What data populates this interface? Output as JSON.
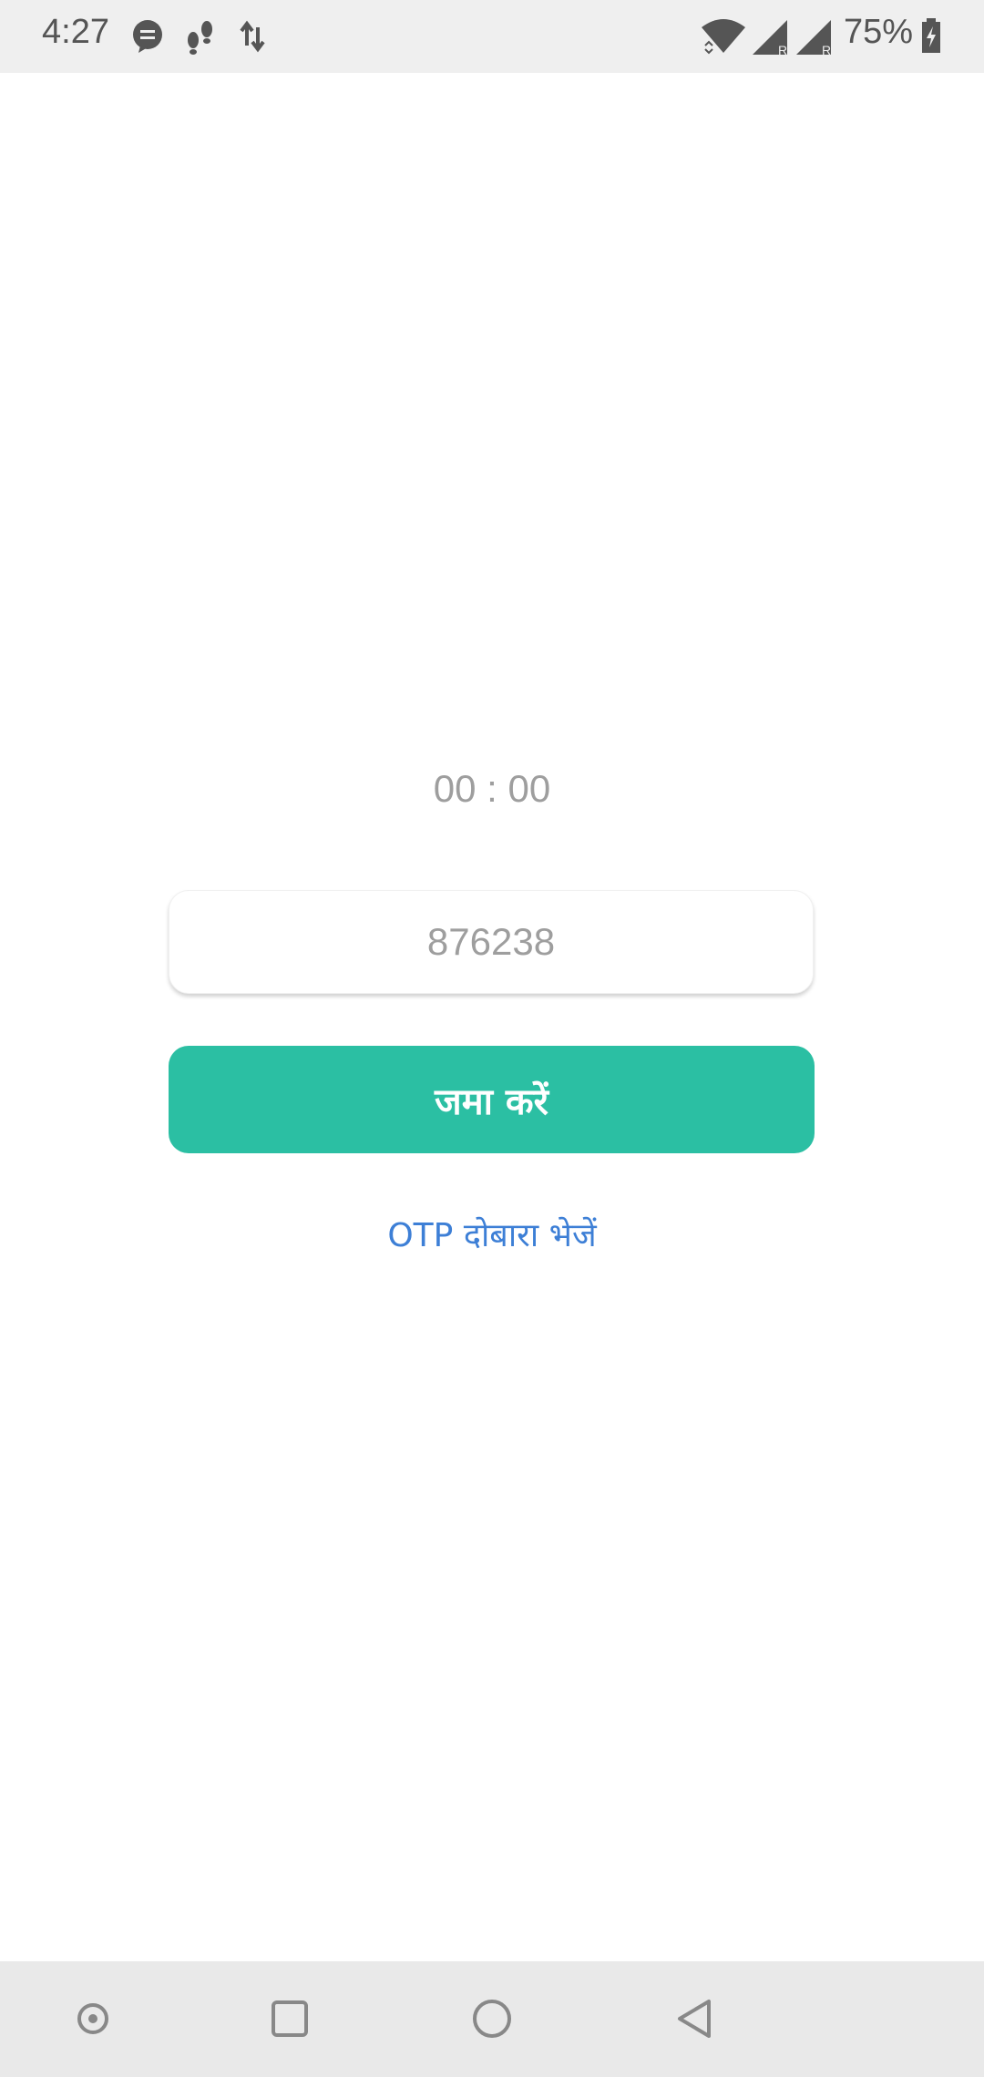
{
  "status_bar": {
    "time": "4:27",
    "battery_percent": "75%",
    "icons": [
      "chat-bubble-icon",
      "footsteps-icon",
      "data-transfer-icon",
      "wifi-icon",
      "signal-roaming-icon",
      "signal-roaming-icon-2",
      "battery-charging-icon"
    ]
  },
  "otp": {
    "timer": "00 : 00",
    "code_value": "876238",
    "submit_label": "जमा करें",
    "resend_label": "OTP दोबारा भेजें"
  },
  "nav_bar": {
    "buttons": [
      "screen-record-icon",
      "recents-icon",
      "home-icon",
      "back-icon"
    ]
  },
  "colors": {
    "accent": "#2bbfa3",
    "link": "#3d7fd6",
    "muted_text": "#9e9e9e"
  }
}
